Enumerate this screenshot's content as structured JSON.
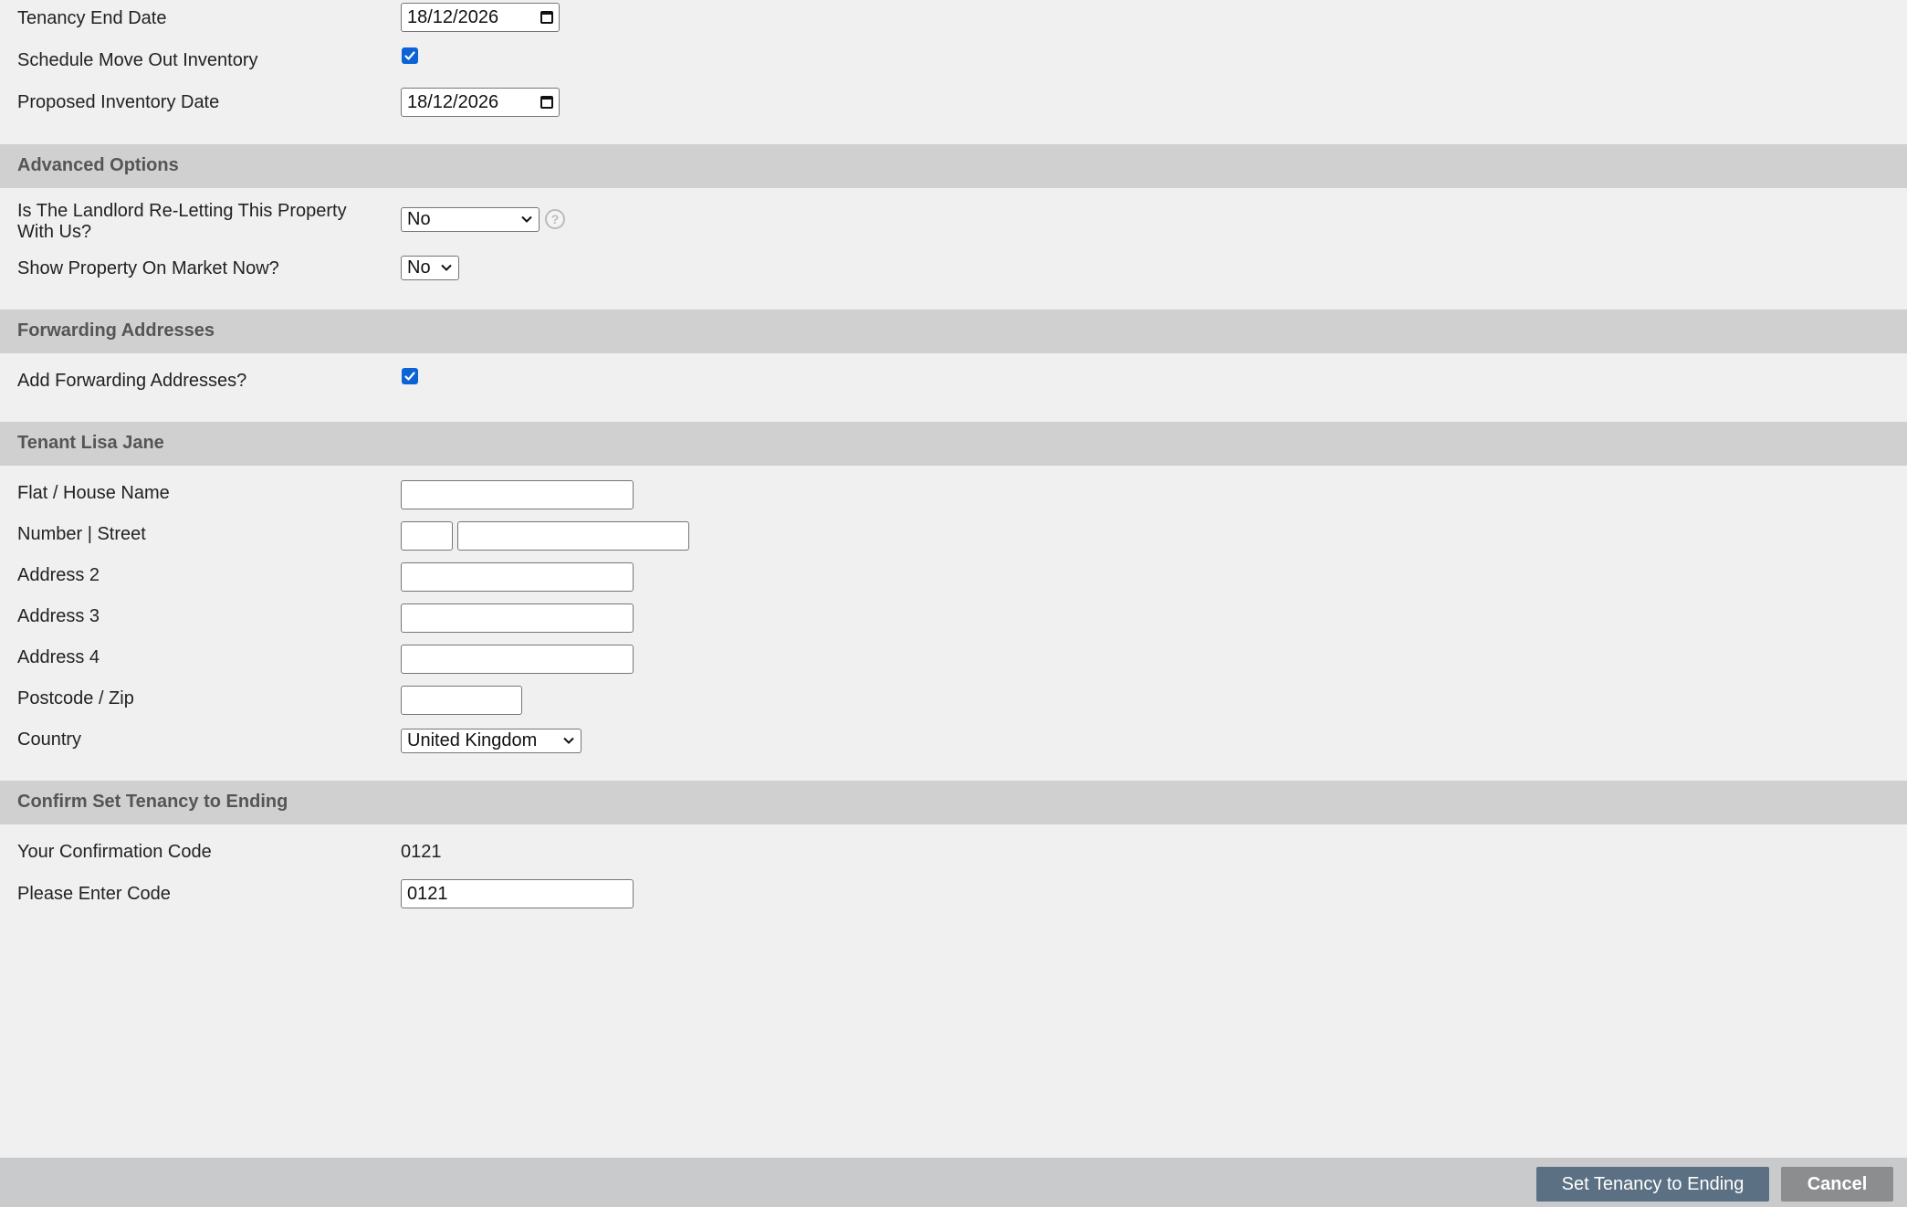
{
  "tenancy": {
    "end_date_label": "Tenancy End Date",
    "end_date_value": "18/12/2026",
    "schedule_label": "Schedule Move Out Inventory",
    "schedule_checked": true,
    "inventory_date_label": "Proposed Inventory Date",
    "inventory_date_value": "18/12/2026"
  },
  "advanced": {
    "title": "Advanced Options",
    "reletting_label_line1": "Is The Landlord Re-Letting This Property",
    "reletting_label_line2": "With Us?",
    "reletting_value": "No",
    "help_glyph": "?",
    "market_label": "Show Property On Market Now?",
    "market_value": "No"
  },
  "forwarding": {
    "title": "Forwarding Addresses",
    "add_label": "Add Forwarding Addresses?",
    "add_checked": true
  },
  "tenant": {
    "title": "Tenant Lisa Jane",
    "flat_label": "Flat / House Name",
    "flat_value": "",
    "number_street_label": "Number | Street",
    "number_value": "",
    "street_value": "",
    "address2_label": "Address 2",
    "address2_value": "",
    "address3_label": "Address 3",
    "address3_value": "",
    "address4_label": "Address 4",
    "address4_value": "",
    "postcode_label": "Postcode / Zip",
    "postcode_value": "",
    "country_label": "Country",
    "country_value": "United Kingdom"
  },
  "confirm": {
    "title": "Confirm Set Tenancy to Ending",
    "code_label": "Your Confirmation Code",
    "code_value": "0121",
    "enter_label": "Please Enter Code",
    "enter_value": "0121"
  },
  "footer": {
    "submit_label": "Set Tenancy to Ending",
    "cancel_label": "Cancel"
  },
  "colors": {
    "background": "#f0f0f0",
    "section_bar": "#d0d0d0",
    "checkbox": "#0b63d6",
    "primary_button": "#5b7083",
    "cancel_button": "#8c8d8f"
  }
}
